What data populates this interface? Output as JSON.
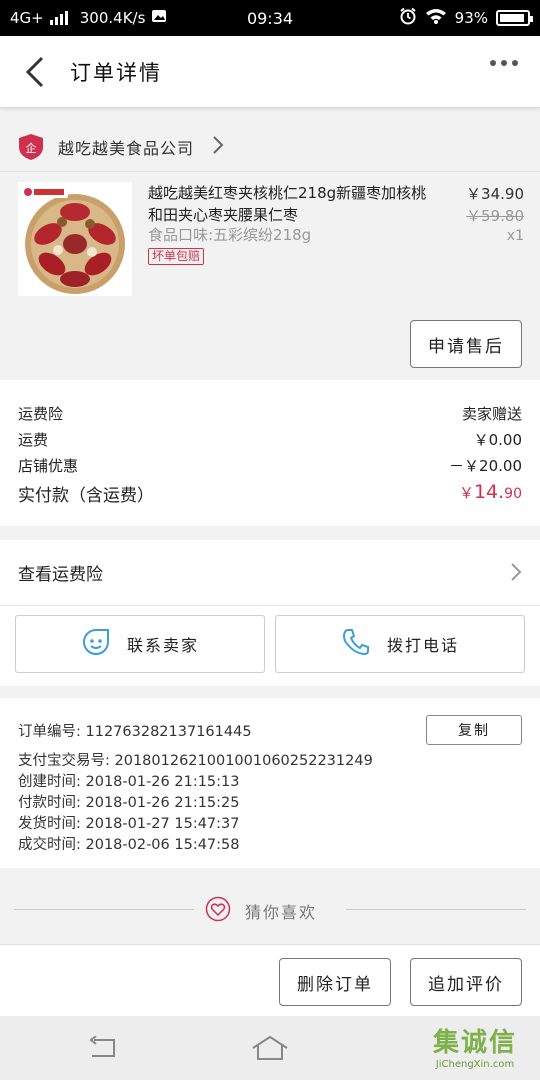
{
  "status_bar": {
    "network": "4G+",
    "speed": "300.4K/s",
    "time": "09:34",
    "battery": "93%",
    "battery_level": 0.93
  },
  "header": {
    "title": "订单详情"
  },
  "shop": {
    "name": "越吃越美食品公司"
  },
  "product": {
    "title": "越吃越美红枣夹核桃仁218g新疆枣加核桃和田夹心枣夹腰果仁枣",
    "sku": "食品口味:五彩缤纷218g",
    "badge": "坏单包赔",
    "price": "￥34.90",
    "original_price": "￥59.80",
    "quantity": "x1",
    "aftersale_button": "申请售后"
  },
  "summary": {
    "shipping_insurance_label": "运费险",
    "shipping_insurance_value": "卖家赠送",
    "shipping_label": "运费",
    "shipping_value": "￥0.00",
    "discount_label": "店铺优惠",
    "discount_value": "－￥20.00",
    "paid_label": "实付款（含运费）",
    "paid_symbol": "￥",
    "paid_integer": "14.",
    "paid_decimal": "90"
  },
  "insurance_link": {
    "label": "查看运费险"
  },
  "contacts": {
    "seller": "联系卖家",
    "call": "拨打电话"
  },
  "order_info": {
    "order_no": "订单编号: 112763282137161445",
    "alipay_no": "支付宝交易号: 2018012621001001060252231249",
    "created": "创建时间: 2018-01-26 21:15:13",
    "paid": "付款时间: 2018-01-26 21:15:25",
    "shipped": "发货时间: 2018-01-27 15:47:37",
    "completed": "成交时间: 2018-02-06 15:47:58",
    "copy_button": "复制"
  },
  "guess": {
    "label": "猜你喜欢"
  },
  "actions": {
    "delete": "删除订单",
    "review": "追加评价"
  },
  "watermark": {
    "logo": "集诚信",
    "url": "JiChengXin.com"
  },
  "colors": {
    "accent_red": "#d0304f",
    "icon_blue": "#3aa0d8"
  }
}
